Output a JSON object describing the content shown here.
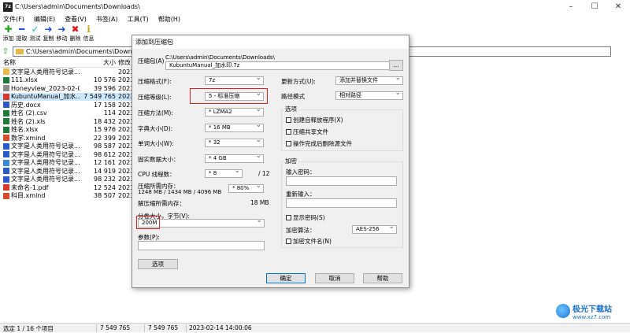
{
  "window": {
    "title": "C:\\Users\\admin\\Documents\\Downloads\\",
    "app_icon_label": "7z"
  },
  "menu": [
    "文件(F)",
    "编辑(E)",
    "查看(V)",
    "书签(A)",
    "工具(T)",
    "帮助(H)"
  ],
  "toolbar": [
    {
      "label": "添加",
      "icon": "plus-icon",
      "color": "#1aa81a",
      "glyph": "✚"
    },
    {
      "label": "提取",
      "icon": "minus-icon",
      "color": "#1a4fd8",
      "glyph": "━"
    },
    {
      "label": "测试",
      "icon": "check-icon",
      "color": "#1ab0c8",
      "glyph": "✓"
    },
    {
      "label": "复制",
      "icon": "copy-arrow-icon",
      "color": "#1a4fd8",
      "glyph": "➜"
    },
    {
      "label": "移动",
      "icon": "move-arrow-icon",
      "color": "#1a4fd8",
      "glyph": "➜"
    },
    {
      "label": "删除",
      "icon": "delete-x-icon",
      "color": "#e01a1a",
      "glyph": "✖"
    },
    {
      "label": "信息",
      "icon": "info-icon",
      "color": "#c8a81a",
      "glyph": "ℹ"
    }
  ],
  "address": "C:\\Users\\admin\\Documents\\Downloads\\",
  "file_list": {
    "headers": {
      "name": "名称",
      "size": "大小",
      "modified": "修改"
    },
    "rows": [
      {
        "name": "文字是人类用符号记录...",
        "size": "",
        "mod": "2023",
        "icon": "folder",
        "color": "#e8b84a"
      },
      {
        "name": "111.xlsx",
        "size": "10 576",
        "mod": "2023",
        "icon": "excel",
        "color": "#1f7a3a"
      },
      {
        "name": "Honeyview_2023-02-0...",
        "size": "39 596",
        "mod": "2023",
        "icon": "image",
        "color": "#8a8a8a"
      },
      {
        "name": "KubuntuManual_加水...",
        "size": "7 549 765",
        "mod": "2023",
        "icon": "pdf",
        "color": "#d83a2a",
        "selected": true
      },
      {
        "name": "历史.docx",
        "size": "17 158",
        "mod": "2023",
        "icon": "word",
        "color": "#2a5bc8"
      },
      {
        "name": "姓名 (2).csv",
        "size": "114",
        "mod": "2023",
        "icon": "csv",
        "color": "#1f7a3a"
      },
      {
        "name": "姓名 (2).xls",
        "size": "18 432",
        "mod": "2023",
        "icon": "excel",
        "color": "#1f7a3a"
      },
      {
        "name": "姓名.xlsx",
        "size": "15 976",
        "mod": "2023",
        "icon": "excel",
        "color": "#1f7a3a"
      },
      {
        "name": "数学.xmind",
        "size": "22 399",
        "mod": "2023",
        "icon": "xmind",
        "color": "#d84a2a"
      },
      {
        "name": "文字是人类用符号记录...",
        "size": "98 587",
        "mod": "2023",
        "icon": "word",
        "color": "#2a5bc8"
      },
      {
        "name": "文字是人类用符号记录...",
        "size": "98 612",
        "mod": "2023",
        "icon": "word",
        "color": "#2a5bc8"
      },
      {
        "name": "文字是人类用符号记录...",
        "size": "12 161",
        "mod": "2023",
        "icon": "image",
        "color": "#3a8ad8"
      },
      {
        "name": "文字是人类用符号记录...",
        "size": "14 919",
        "mod": "2023",
        "icon": "word",
        "color": "#2a5bc8"
      },
      {
        "name": "文字是人类用符号记录...",
        "size": "98 232",
        "mod": "2023",
        "icon": "word",
        "color": "#2a5bc8"
      },
      {
        "name": "未命名-1.pdf",
        "size": "12 524",
        "mod": "2023",
        "icon": "pdf",
        "color": "#d83a2a"
      },
      {
        "name": "科目.xmind",
        "size": "38 507",
        "mod": "2023",
        "icon": "xmind",
        "color": "#d84a2a"
      }
    ]
  },
  "status": {
    "selection": "选定 1 / 16 个项目",
    "size1": "7 549 765",
    "size2": "7 549 765",
    "date": "2023-02-14 14:00:06"
  },
  "dialog": {
    "title": "添加到压缩包",
    "archive_label": "压缩包(A)",
    "archive_dir": "C:\\Users\\admin\\Documents\\Downloads\\",
    "archive_name": "KubuntuManual_加水印.7z",
    "browse_label": "...",
    "format_label": "压缩格式(F):",
    "format_value": "7z",
    "level_label": "压缩等级(L):",
    "level_value": "5 - 标准压缩",
    "method_label": "压缩方法(M):",
    "method_value": "* LZMA2",
    "dict_label": "字典大小(D):",
    "dict_value": "* 16 MB",
    "word_label": "单词大小(W):",
    "word_value": "* 32",
    "solid_label": "固实数据大小：",
    "solid_value": "* 4 GB",
    "cpu_label": "CPU 线程数：",
    "cpu_value": "* 8",
    "cpu_max": "/ 12",
    "mem_label": "压缩所需内存：",
    "mem_value": "1248 MB / 1434 MB / 4096 MB",
    "mem_pct": "* 80%",
    "decomp_label": "解压缩所需内存：",
    "decomp_value": "18 MB",
    "split_label": "分卷大小，字节(V):",
    "split_value": "200M",
    "params_label": "参数(P):",
    "options_button": "选项",
    "update_label": "更新方式(U):",
    "update_value": "添加并替换文件",
    "path_label": "路径模式",
    "path_value": "相对路径",
    "options_group": "选项",
    "opt1": "创建自释放程序(X)",
    "opt2": "压缩共享文件",
    "opt3": "操作完成后删除源文件",
    "encrypt_group": "加密",
    "pwd_label": "输入密码：",
    "pwd2_label": "重新输入：",
    "show_pwd": "显示密码(S)",
    "enc_method_label": "加密算法：",
    "enc_method_value": "AES-256",
    "enc_names": "加密文件名(N)",
    "ok": "确定",
    "cancel": "取消",
    "help": "帮助"
  },
  "watermark": {
    "name": "极光下载站",
    "url": "www.xz7.com"
  }
}
